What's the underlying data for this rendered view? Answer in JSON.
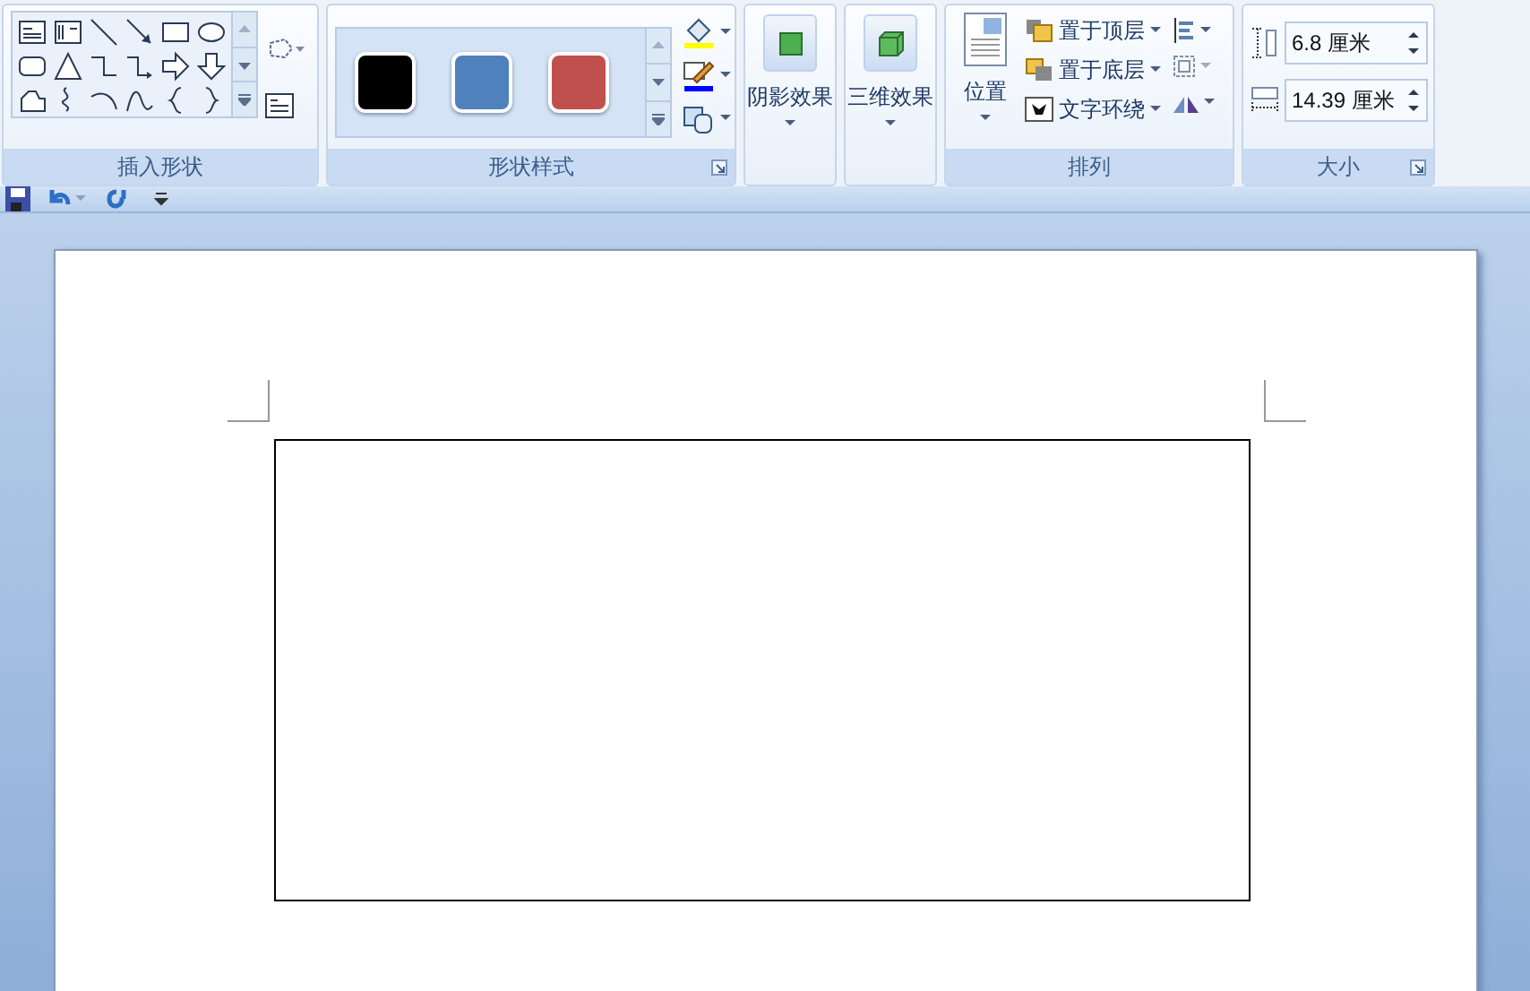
{
  "shape_gallery": {
    "label": "插入形状"
  },
  "shape_styles": {
    "swatches": [
      {
        "color": "#000000"
      },
      {
        "color": "#4f81bd"
      },
      {
        "color": "#c0504d"
      }
    ],
    "label": "形状样式"
  },
  "shadow_effects": {
    "label": "阴影效果"
  },
  "threed_effects": {
    "label": "三维效果"
  },
  "arrange": {
    "position": "位置",
    "items": [
      {
        "kind": "front",
        "label": "置于顶层"
      },
      {
        "kind": "back",
        "label": "置于底层"
      },
      {
        "kind": "wrap",
        "label": "文字环绕"
      }
    ],
    "label": "排列"
  },
  "size": {
    "fields": [
      {
        "kind": "height",
        "value": "6.8 厘米"
      },
      {
        "kind": "width",
        "value": "14.39 厘米"
      }
    ],
    "label": "大小"
  }
}
